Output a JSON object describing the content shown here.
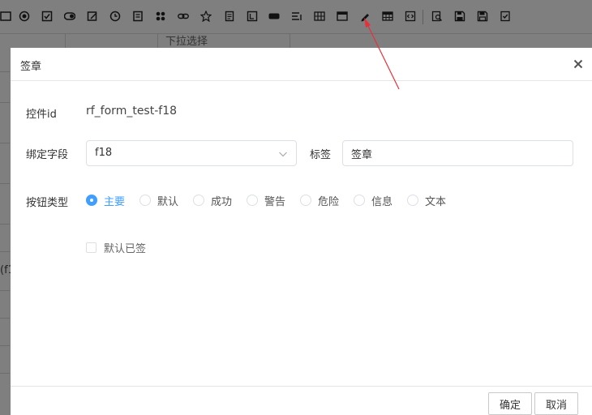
{
  "background": {
    "column_hint": "下拉选择",
    "side_fragment": "(f1"
  },
  "dialog": {
    "title": "签章",
    "control_id_label": "控件id",
    "control_id_value": "rf_form_test-f18",
    "bind_field_label": "绑定字段",
    "bind_field_value": "f18",
    "tag_label": "标签",
    "tag_value": "签章",
    "button_type_label": "按钮类型",
    "button_types": [
      {
        "label": "主要",
        "checked": true
      },
      {
        "label": "默认",
        "checked": false
      },
      {
        "label": "成功",
        "checked": false
      },
      {
        "label": "警告",
        "checked": false
      },
      {
        "label": "危险",
        "checked": false
      },
      {
        "label": "信息",
        "checked": false
      },
      {
        "label": "文本",
        "checked": false
      }
    ],
    "default_signed_label": "默认已签",
    "confirm_label": "确定",
    "cancel_label": "取消"
  },
  "colors": {
    "accent": "#409eff",
    "overlay": "#7f7f7f",
    "annotation_arrow": "#e8303a"
  }
}
